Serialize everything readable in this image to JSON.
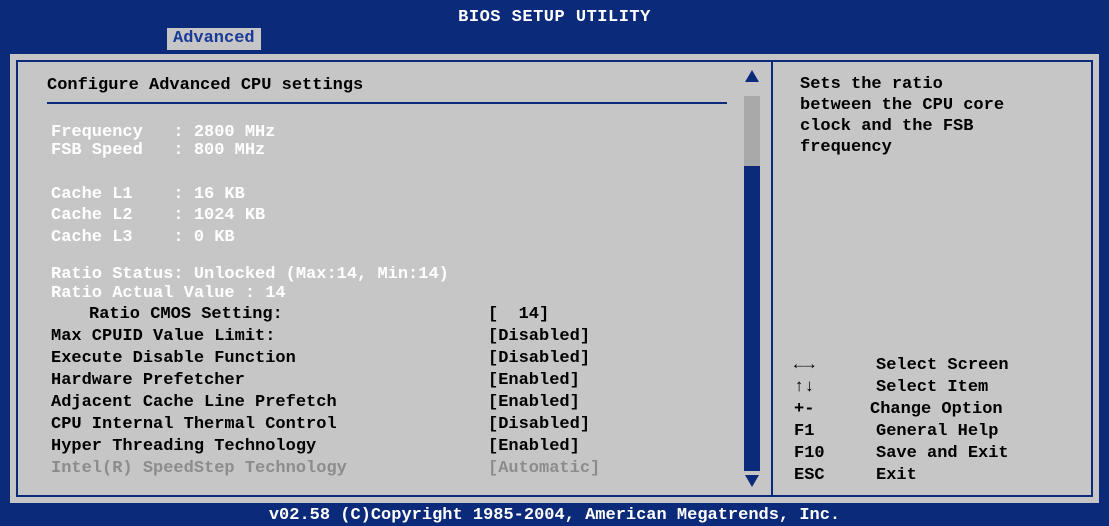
{
  "window": {
    "title": "BIOS SETUP UTILITY",
    "active_tab": "Advanced"
  },
  "main": {
    "heading": "Configure Advanced CPU settings",
    "info_lines": [
      "Frequency   : 2800 MHz",
      "FSB Speed   : 800 MHz",
      "Cache L1    : 16 KB",
      "Cache L2    : 1024 KB",
      "Cache L3    : 0 KB",
      "Ratio Status: Unlocked (Max:14, Min:14)",
      "Ratio Actual Value : 14"
    ],
    "settings": [
      {
        "label": "Ratio CMOS Setting:",
        "value": "[  14]"
      },
      {
        "label": "Max CPUID Value Limit:",
        "value": "[Disabled]"
      },
      {
        "label": "Execute Disable Function",
        "value": "[Disabled]"
      },
      {
        "label": "Hardware Prefetcher",
        "value": "[Enabled]"
      },
      {
        "label": "Adjacent Cache Line Prefetch",
        "value": "[Enabled]"
      },
      {
        "label": "CPU Internal Thermal Control",
        "value": "[Disabled]"
      },
      {
        "label": "Hyper Threading Technology",
        "value": "[Enabled]"
      },
      {
        "label": "Intel(R) SpeedStep Technology",
        "value": "[Automatic]"
      }
    ]
  },
  "help": {
    "lines": [
      "Sets the ratio",
      "between the CPU core",
      "clock and the FSB",
      "frequency"
    ]
  },
  "keys": [
    {
      "key": "←→",
      "desc": "Select Screen"
    },
    {
      "key": "↑↓",
      "desc": "Select Item"
    },
    {
      "key": "+-",
      "desc": "Change Option"
    },
    {
      "key": "F1",
      "desc": "General Help"
    },
    {
      "key": "F10",
      "desc": "Save and Exit"
    },
    {
      "key": "ESC",
      "desc": "Exit"
    }
  ],
  "footer": {
    "text": "v02.58 (C)Copyright 1985-2004, American Megatrends, Inc."
  },
  "colors": {
    "background": "#0b2a7a",
    "panel": "#c6c6c6",
    "info_text": "#ffffff",
    "disabled_text": "#8c8c8c"
  }
}
